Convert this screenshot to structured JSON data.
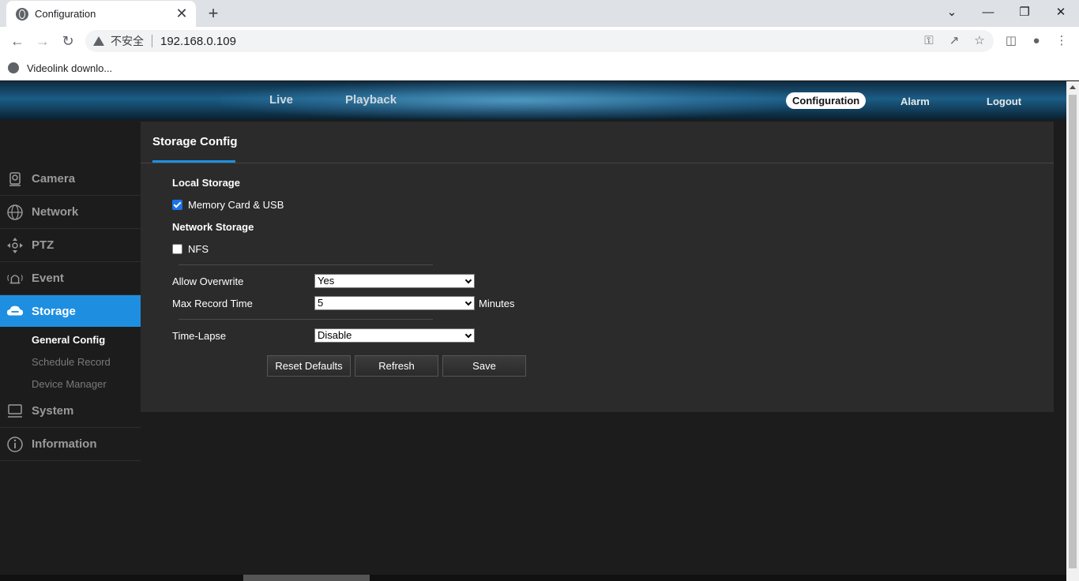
{
  "browser": {
    "tab_title": "Configuration",
    "tab_close": "✕",
    "new_tab": "+",
    "insecure_label": "不安全",
    "url": "192.168.0.109",
    "bookmark": "Videolink downlo..."
  },
  "header": {
    "nav_live": "Live",
    "nav_playback": "Playback",
    "nav_configuration": "Configuration",
    "nav_alarm": "Alarm",
    "nav_logout": "Logout"
  },
  "sidebar": {
    "items": [
      {
        "label": "Camera",
        "icon": "camera-icon"
      },
      {
        "label": "Network",
        "icon": "globe-icon"
      },
      {
        "label": "PTZ",
        "icon": "ptz-icon"
      },
      {
        "label": "Event",
        "icon": "bell-icon"
      },
      {
        "label": "Storage",
        "icon": "cloud-icon"
      },
      {
        "label": "System",
        "icon": "monitor-icon"
      },
      {
        "label": "Information",
        "icon": "info-icon"
      }
    ],
    "storage_sub": [
      "General Config",
      "Schedule Record",
      "Device Manager"
    ]
  },
  "panel": {
    "tab": "Storage Config",
    "local_storage_title": "Local Storage",
    "memory_card_label": "Memory Card & USB",
    "memory_card_checked": true,
    "network_storage_title": "Network Storage",
    "nfs_label": "NFS",
    "nfs_checked": false,
    "allow_overwrite_label": "Allow Overwrite",
    "allow_overwrite_value": "Yes",
    "max_record_label": "Max Record Time",
    "max_record_value": "5",
    "max_record_unit": "Minutes",
    "time_lapse_label": "Time-Lapse",
    "time_lapse_value": "Disable",
    "btn_reset": "Reset Defaults",
    "btn_refresh": "Refresh",
    "btn_save": "Save"
  },
  "colors": {
    "accent": "#1e8fe0",
    "panel_bg": "#2b2b2b",
    "page_bg": "#1c1c1c"
  }
}
